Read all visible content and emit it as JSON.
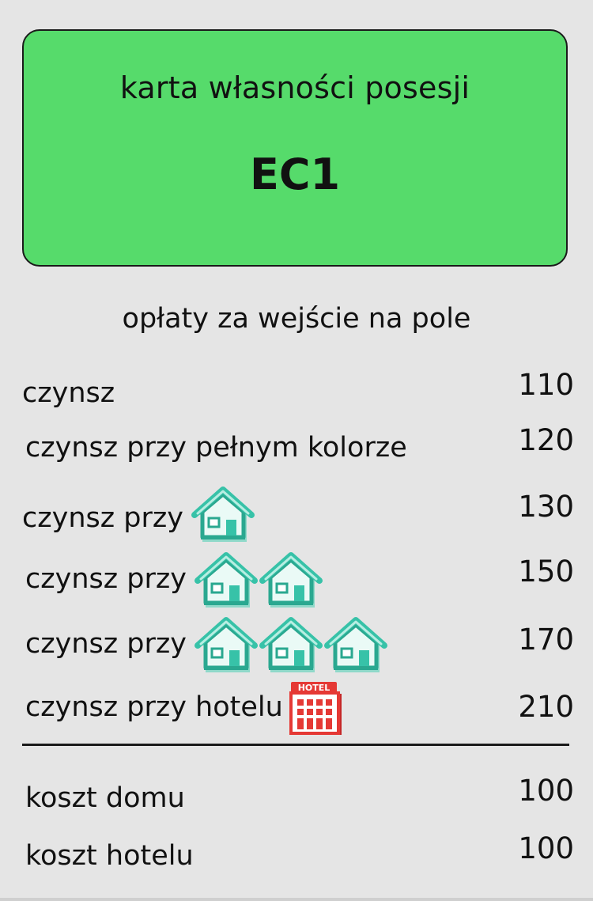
{
  "card": {
    "subtitle": "karta własności posesji",
    "code": "EC1",
    "color": "#56db6b"
  },
  "fees_heading": "opłaty za wejście na pole",
  "rent": {
    "base_label": "czynsz",
    "base_value": "110",
    "full_color_label": "czynsz przy pełnym kolorze",
    "full_color_value": "120",
    "one_house_label": "czynsz przy",
    "one_house_value": "130",
    "two_houses_label": "czynsz przy",
    "two_houses_value": "150",
    "three_houses_label": "czynsz przy",
    "three_houses_value": "170",
    "hotel_label": "czynsz przy hotelu",
    "hotel_value": "210",
    "house_icon": "house-icon",
    "hotel_icon": "hotel-icon",
    "hotel_sign": "HOTEL",
    "house_color": "#37c2a8",
    "hotel_color": "#e53935"
  },
  "costs": {
    "house_label": "koszt domu",
    "house_value": "100",
    "hotel_label": "koszt hotelu",
    "hotel_value": "100"
  }
}
